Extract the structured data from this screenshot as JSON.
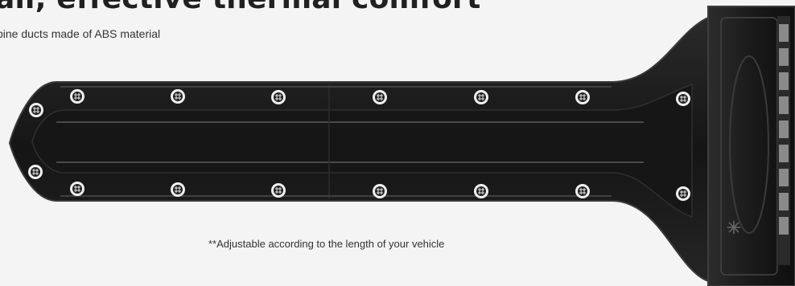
{
  "hero": {
    "headline": "air, effective thermal comfort",
    "subline": "bine ducts made of ABS material",
    "footnote": "**Adjustable according to the length of your vehicle"
  },
  "product": {
    "name": "cabin air duct",
    "material": "ABS",
    "colors": {
      "body": "#1b1b1b",
      "edge": "#3a3a3a",
      "highlight": "#555555",
      "screw_ring": "#f0f0f0",
      "screw_head": "#222222",
      "label": "#8a8a8a"
    },
    "icon": "snowflake-icon"
  }
}
